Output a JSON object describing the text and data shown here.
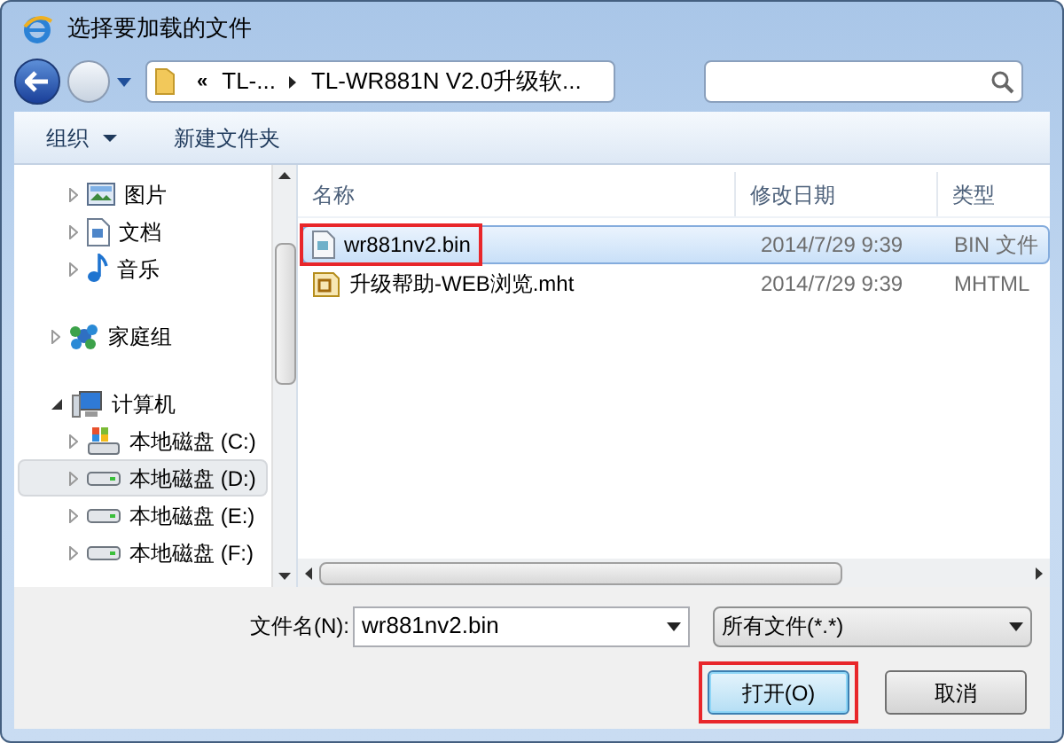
{
  "window": {
    "title": "选择要加载的文件"
  },
  "breadcrumb": [
    "«",
    "TL-...",
    "TL-WR881N V2.0升级软..."
  ],
  "toolbar": [
    "组织",
    "新建文件夹"
  ],
  "nav_tree": [
    {
      "label": "图片",
      "expanded": false,
      "selected": false
    },
    {
      "label": "文档",
      "expanded": false,
      "selected": false
    },
    {
      "label": "音乐",
      "expanded": false,
      "selected": false
    },
    {
      "label": "家庭组",
      "expanded": false,
      "selected": false
    },
    {
      "label": "计算机",
      "expanded": true,
      "selected": false,
      "children": [
        {
          "label": "本地磁盘 (C:)",
          "expanded": false,
          "selected": false
        },
        {
          "label": "本地磁盘 (D:)",
          "expanded": false,
          "selected": true
        },
        {
          "label": "本地磁盘 (E:)",
          "expanded": false,
          "selected": false
        },
        {
          "label": "本地磁盘 (F:)",
          "expanded": false,
          "selected": false
        }
      ]
    }
  ],
  "table": {
    "columns": [
      "名称",
      "修改日期",
      "类型"
    ],
    "rows": [
      {
        "name": "wr881nv2.bin",
        "date": "2014/7/29 9:39",
        "type": "BIN 文件",
        "selected": true,
        "highlighted": true
      },
      {
        "name": "升级帮助-WEB浏览.mht",
        "date": "2014/7/29 9:39",
        "type": "MHTML",
        "selected": false,
        "highlighted": false
      }
    ]
  },
  "filename": {
    "label": "文件名(N):",
    "value": "wr881nv2.bin"
  },
  "filetype": {
    "value": "所有文件(*.*)"
  },
  "buttons": [
    {
      "label": "打开(O)",
      "default": true,
      "highlighted": true
    },
    {
      "label": "取消",
      "default": false,
      "highlighted": false
    }
  ]
}
